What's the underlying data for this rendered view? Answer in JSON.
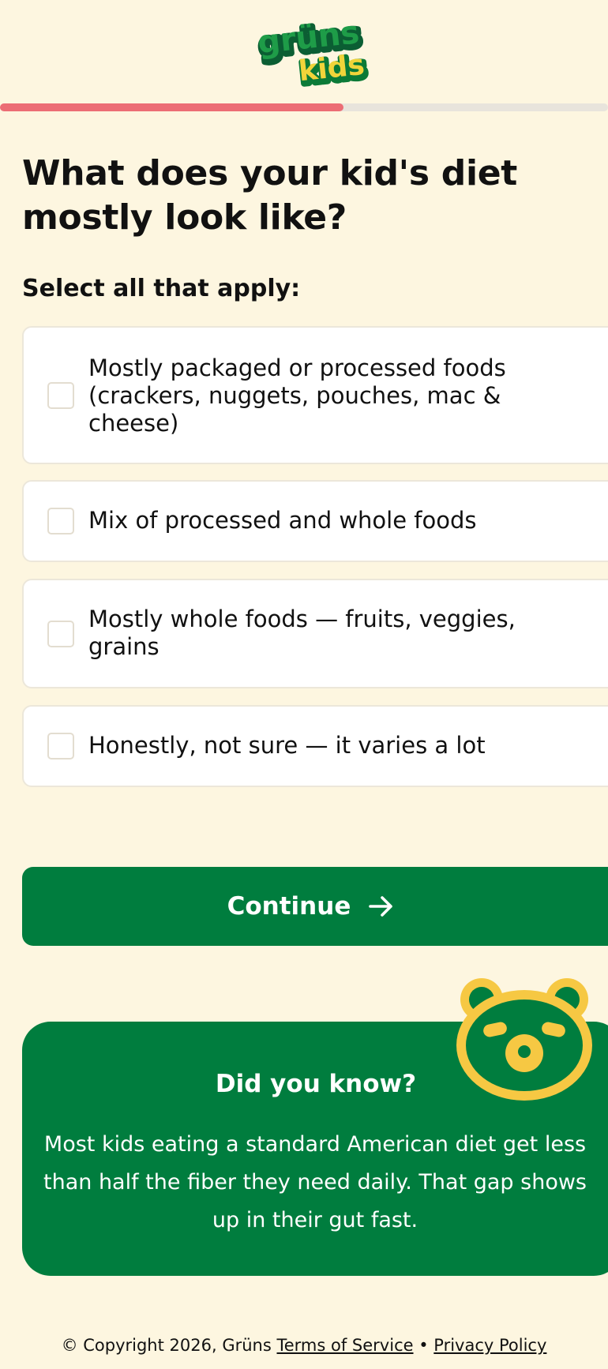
{
  "brand": {
    "logo_top": "grüns",
    "logo_bottom": "kids",
    "green": "#007d3e",
    "yellow": "#f6c843",
    "accent_pink": "#ec6d75"
  },
  "progress": {
    "fraction": 0.565
  },
  "question": {
    "title": "What does your kid's diet mostly look like?",
    "subtitle": "Select all that apply:",
    "options": [
      {
        "label": "Mostly packaged or processed foods (crackers, nuggets, pouches, mac & cheese)",
        "checked": false
      },
      {
        "label": "Mix of processed and whole foods",
        "checked": false
      },
      {
        "label": "Mostly whole foods — fruits, veggies, grains",
        "checked": false
      },
      {
        "label": "Honestly, not sure — it varies a lot",
        "checked": false
      }
    ]
  },
  "continue_button": {
    "label": "Continue",
    "icon": "arrow-right-icon"
  },
  "info_card": {
    "title": "Did you know?",
    "body": "Most kids eating a standard American diet get less than half the fiber they need daily. That gap shows up in their gut fast.",
    "icon": "bear-icon"
  },
  "footer": {
    "copyright": "© Copyright 2026, Grüns",
    "terms": "Terms of Service",
    "separator": "•",
    "privacy": "Privacy Policy"
  }
}
